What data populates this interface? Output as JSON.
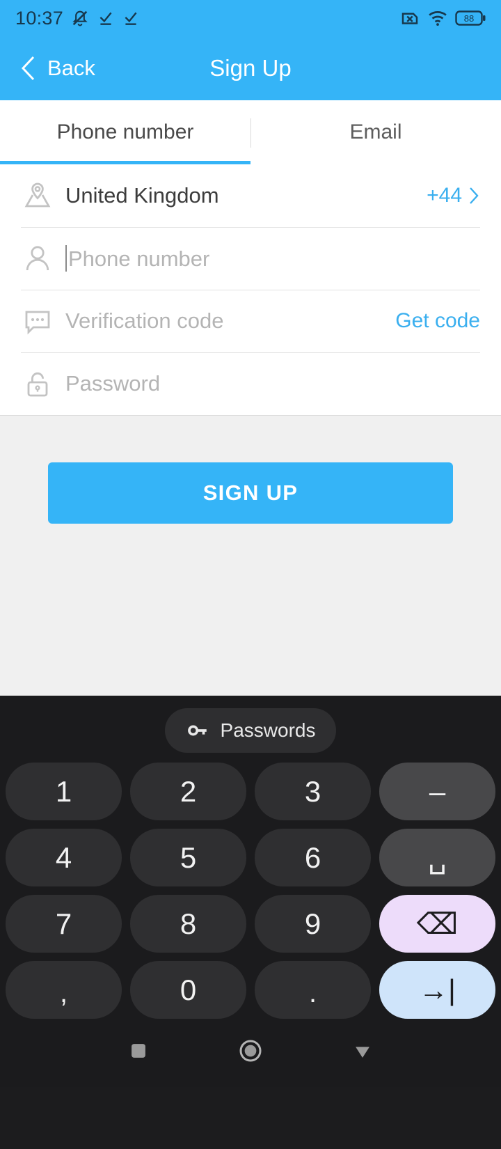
{
  "statusbar": {
    "time": "10:37",
    "icons_left": [
      "bell-mute-icon",
      "check-underline-icon",
      "check-underline-icon"
    ],
    "icons_right": [
      "sim-disabled-icon",
      "wifi-icon",
      "battery-icon"
    ],
    "battery_level": "88"
  },
  "appbar": {
    "back_label": "Back",
    "back_icon": "chevron-left-icon",
    "title": "Sign Up",
    "bg_color": "#35b4f7"
  },
  "tabs": {
    "items": [
      {
        "label": "Phone number",
        "active": true
      },
      {
        "label": "Email",
        "active": false
      }
    ],
    "active_color": "#35b4f7"
  },
  "form": {
    "country": {
      "icon": "map-pin-icon",
      "value": "United Kingdom",
      "dial_code": "+44",
      "chevron": "chevron-right-icon"
    },
    "phone": {
      "icon": "person-icon",
      "value": "",
      "placeholder": "Phone number"
    },
    "verification": {
      "icon": "message-dots-icon",
      "value": "",
      "placeholder": "Verification code",
      "action_label": "Get code"
    },
    "password": {
      "icon": "unlock-icon",
      "value": "",
      "placeholder": "Password"
    },
    "link_color": "#3aafef"
  },
  "main": {
    "submit_label": "SIGN UP",
    "submit_color": "#35b4f7",
    "bg_color": "#f0f0f0"
  },
  "keyboard": {
    "suggestion": {
      "icon": "key-icon",
      "label": "Passwords"
    },
    "rows": [
      [
        {
          "label": "1",
          "name": "key-1",
          "type": "digit"
        },
        {
          "label": "2",
          "name": "key-2",
          "type": "digit"
        },
        {
          "label": "3",
          "name": "key-3",
          "type": "digit"
        },
        {
          "label": "–",
          "name": "key-dash",
          "type": "fn"
        }
      ],
      [
        {
          "label": "4",
          "name": "key-4",
          "type": "digit"
        },
        {
          "label": "5",
          "name": "key-5",
          "type": "digit"
        },
        {
          "label": "6",
          "name": "key-6",
          "type": "digit"
        },
        {
          "label": "␣",
          "name": "key-space",
          "type": "fn"
        }
      ],
      [
        {
          "label": "7",
          "name": "key-7",
          "type": "digit"
        },
        {
          "label": "8",
          "name": "key-8",
          "type": "digit"
        },
        {
          "label": "9",
          "name": "key-9",
          "type": "digit"
        },
        {
          "label": "⌫",
          "name": "key-backspace",
          "type": "del"
        }
      ],
      [
        {
          "label": ",",
          "name": "key-comma",
          "type": "punct"
        },
        {
          "label": "0",
          "name": "key-0",
          "type": "digit"
        },
        {
          "label": ".",
          "name": "key-period",
          "type": "punct"
        },
        {
          "label": "→|",
          "name": "key-next",
          "type": "enter"
        }
      ]
    ],
    "bg_color": "#1b1b1d",
    "key_color": "#2f2f31",
    "delete_key_color": "#eddcfa",
    "enter_key_color": "#cfe4fa"
  },
  "navbar": {
    "items": [
      {
        "name": "recents-button",
        "icon": "square-icon"
      },
      {
        "name": "home-button",
        "icon": "circle-icon"
      },
      {
        "name": "hide-keyboard-button",
        "icon": "triangle-down-icon"
      }
    ]
  }
}
